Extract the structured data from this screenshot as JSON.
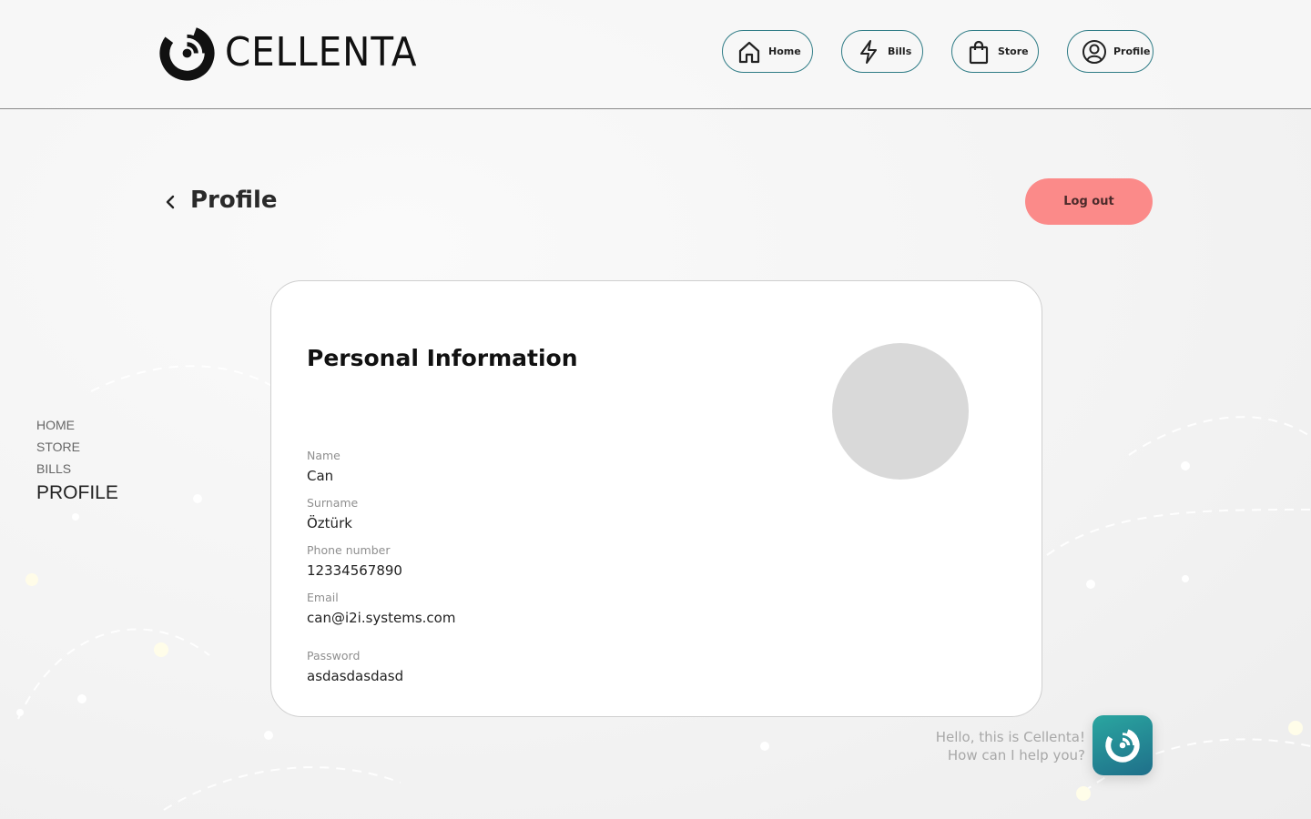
{
  "brand": {
    "name": "CELLENTA"
  },
  "nav": [
    {
      "label": "Home",
      "icon": "home-icon"
    },
    {
      "label": "Bills",
      "icon": "lightning-icon"
    },
    {
      "label": "Store",
      "icon": "shopping-bag-icon"
    },
    {
      "label": "Profile",
      "icon": "user-icon"
    }
  ],
  "page": {
    "title": "Profile",
    "logout_label": "Log out"
  },
  "side_nav": {
    "items": [
      "HOME",
      "STORE",
      "BILLS",
      "PROFILE"
    ],
    "active": "PROFILE"
  },
  "card": {
    "title": "Personal Information",
    "fields": [
      {
        "label": "Name",
        "value": "Can"
      },
      {
        "label": "Surname",
        "value": "Öztürk"
      },
      {
        "label": "Phone number",
        "value": "12334567890"
      },
      {
        "label": "Email",
        "value": "can@i2i.systems.com"
      },
      {
        "label": "Password",
        "value": "asdasdasdasd"
      }
    ]
  },
  "chat": {
    "line1": "Hello, this is Cellenta!",
    "line2": "How can I help you?"
  },
  "colors": {
    "accent": "#2f7c86",
    "logout": "#fb8a89",
    "avatar": "#d9d9d9"
  }
}
